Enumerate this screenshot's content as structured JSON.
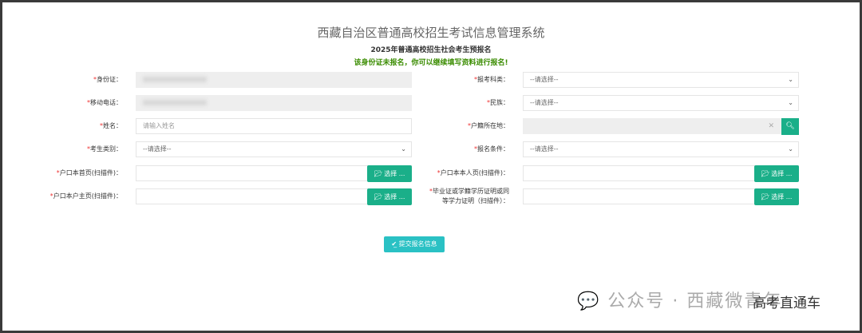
{
  "header": {
    "title": "西藏自治区普通高校招生考试信息管理系统",
    "subtitle": "2025年普通高校招生社会考生预报名",
    "notice": "该身份证未报名，你可以继续填写资料进行报名!"
  },
  "left": [
    {
      "label": "身份证：",
      "type": "readonly",
      "value": ""
    },
    {
      "label": "移动电话：",
      "type": "readonly",
      "value": ""
    },
    {
      "label": "姓名：",
      "type": "text",
      "placeholder": "请输入姓名"
    },
    {
      "label": "考生类别：",
      "type": "select",
      "value": "--请选择--"
    },
    {
      "label": "户口本首页(扫描件)：",
      "type": "file",
      "button": "选择 ..."
    },
    {
      "label": "户口本户主页(扫描件)：",
      "type": "file",
      "button": "选择 ..."
    }
  ],
  "right": [
    {
      "label": "报考科类：",
      "type": "select",
      "value": "--请选择--"
    },
    {
      "label": "民族：",
      "type": "select",
      "value": "--请选择--"
    },
    {
      "label": "户籍所在地：",
      "type": "search",
      "value": ""
    },
    {
      "label": "报名条件：",
      "type": "select",
      "value": "--请选择--"
    },
    {
      "label": "户口本本人页(扫描件)：",
      "type": "file",
      "button": "选择 ..."
    },
    {
      "label": "毕业证或学籍学历证明或同等学力证明（扫描件）：",
      "type": "file",
      "button": "选择 ..."
    }
  ],
  "submit": {
    "label": "提交报名信息",
    "icon": "check-icon"
  },
  "watermark": {
    "text": "公众号 · 西藏微青年",
    "overlay": "高考直通车"
  },
  "colors": {
    "accent": "#1aaf89",
    "submit": "#2ac1c4",
    "notice": "#3a8c00",
    "required": "#e33"
  }
}
